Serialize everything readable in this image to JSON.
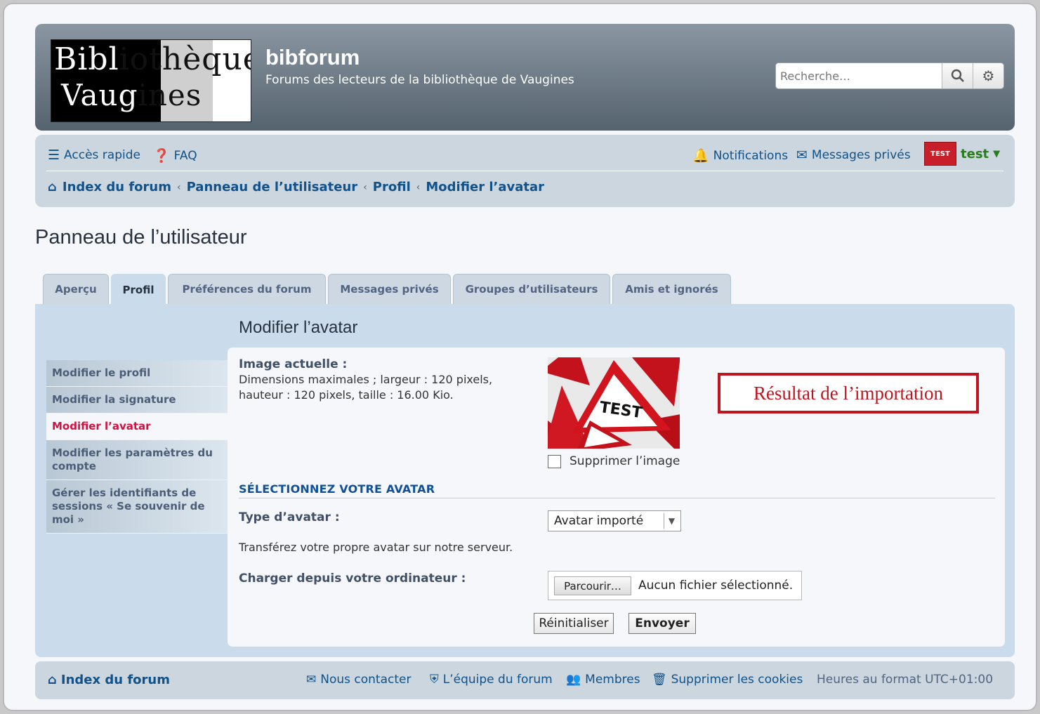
{
  "header": {
    "logo_text": "Bibliothèque de Vaugines",
    "site_title": "bibforum",
    "site_description": "Forums des lecteurs de la bibliothèque de Vaugines",
    "search_placeholder": "Recherche…"
  },
  "navbar": {
    "quick_access": "Accès rapide",
    "faq": "FAQ",
    "notifications": "Notifications",
    "private_messages": "Messages privés",
    "username": "test",
    "avatar_text": "TEST"
  },
  "breadcrumbs": [
    "Index du forum",
    "Panneau de l’utilisateur",
    "Profil",
    "Modifier l’avatar"
  ],
  "page_title": "Panneau de l’utilisateur",
  "tabs": [
    "Aperçu",
    "Profil",
    "Préférences du forum",
    "Messages privés",
    "Groupes d’utilisateurs",
    "Amis et ignorés"
  ],
  "active_tab": "Profil",
  "sidebar": {
    "items": [
      "Modifier le profil",
      "Modifier la signature",
      "Modifier l’avatar",
      "Modifier les paramètres du compte",
      "Gérer les identifiants de sessions « Se souvenir de moi »"
    ],
    "active": "Modifier l’avatar"
  },
  "main": {
    "section_title": "Modifier l’avatar",
    "current_image_label": "Image actuelle :",
    "dimensions_text": "Dimensions maximales ; largeur : 120 pixels, hauteur : 120 pixels, taille : 16.00 Kio.",
    "avatar_image_text": "TEST",
    "delete_image_label": "Supprimer l’image",
    "annotation": "Résultat de l’importation",
    "select_heading": "SÉLECTIONNEZ VOTRE AVATAR",
    "avatar_type_label": "Type d’avatar :",
    "avatar_type_value": "Avatar importé",
    "upload_description": "Transférez votre propre avatar sur notre serveur.",
    "upload_label": "Charger depuis votre ordinateur :",
    "browse_button": "Parcourir…",
    "no_file_text": "Aucun fichier sélectionné.",
    "reset_button": "Réinitialiser",
    "submit_button": "Envoyer"
  },
  "footer": {
    "index": "Index du forum",
    "contact": "Nous contacter",
    "team": "L’équipe du forum",
    "members": "Membres",
    "delete_cookies": "Supprimer les cookies",
    "timezone": "Heures au format UTC+01:00"
  },
  "colors": {
    "link": "#105289",
    "active_menu": "#d31141",
    "annotation": "#c0141e",
    "username": "#2a7d1b"
  }
}
